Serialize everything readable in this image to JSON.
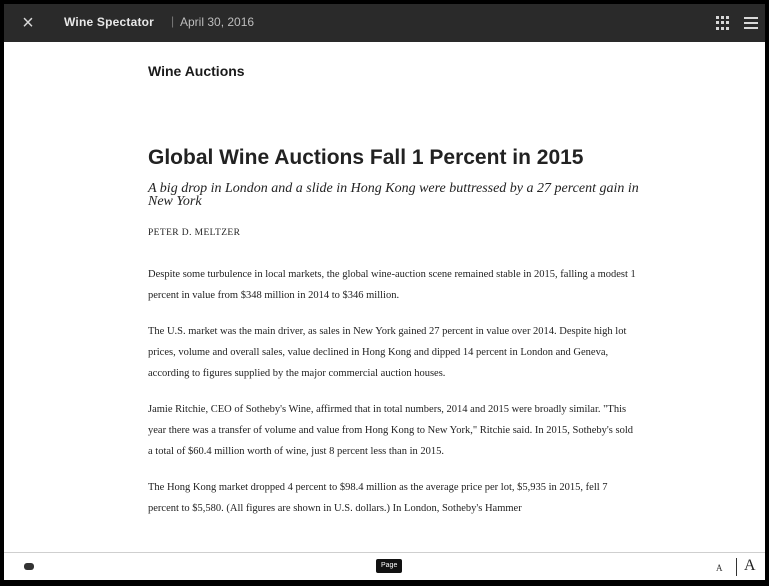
{
  "topbar": {
    "close_icon": "×",
    "publication": "Wine Spectator",
    "separator": "|",
    "date": "April 30, 2016"
  },
  "article": {
    "section": "Wine Auctions",
    "headline": "Global Wine Auctions Fall 1 Percent in 2015",
    "dek": "A big drop in London and a slide in Hong Kong were buttressed by a 27 percent gain in New York",
    "byline": "PETER D. MELTZER",
    "paragraphs": [
      "Despite some turbulence in local markets, the global wine-auction scene remained stable in 2015, falling a modest 1 percent in value from $348 million in 2014 to $346 million.",
      "The U.S. market was the main driver, as sales in New York gained 27 percent in value over 2014. Despite high lot prices, volume and overall sales, value declined in Hong Kong and dipped 14 percent in London and Geneva, according to figures supplied by the major commercial auction houses.",
      "Jamie Ritchie, CEO of Sotheby's Wine, affirmed that in total numbers, 2014 and 2015 were broadly similar. \"This year there was a transfer of volume and value from Hong Kong to New York,\" Ritchie said. In 2015, Sotheby's sold a total of $60.4 million worth of wine, just 8 percent less than in 2015.",
      "The Hong Kong market dropped 4 percent to $98.4 million as the average price per lot, $5,935 in 2015, fell 7 percent to $5,580. (All figures are shown in U.S. dollars.) In London, Sotheby's Hammer"
    ]
  },
  "bottombar": {
    "page_label": "Page",
    "font_small": "A",
    "font_large": "A"
  },
  "icons": {
    "close": "close-icon",
    "grid": "grid-icon",
    "list": "list-icon",
    "chat": "chat-icon"
  }
}
